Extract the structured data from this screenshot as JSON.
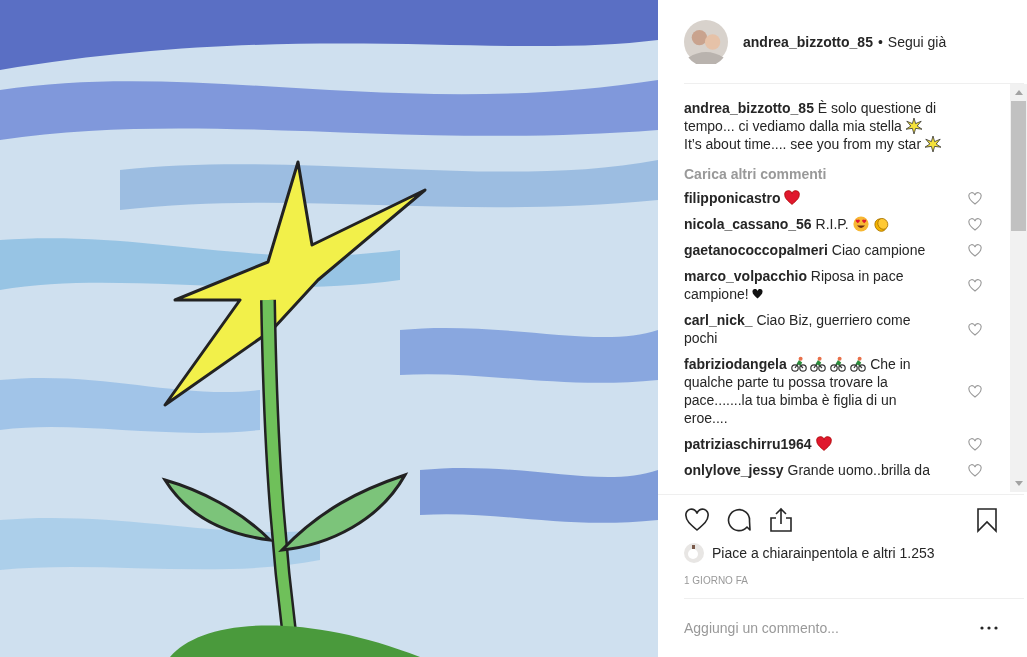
{
  "header": {
    "username": "andrea_bizzotto_85",
    "separator": "•",
    "follow": "Segui già"
  },
  "caption": {
    "username": "andrea_bizzotto_85",
    "lines": [
      [
        {
          "kind": "text",
          "text": "È solo questione di tempo... ci vediamo dalla mia stella"
        },
        {
          "kind": "sparkle"
        }
      ],
      [
        {
          "kind": "text",
          "text": "It’s about time.... see you from my star"
        },
        {
          "kind": "sparkle"
        }
      ]
    ]
  },
  "load_more": "Carica altri commenti",
  "comments": [
    {
      "username": "filipponicastro",
      "parts": [
        {
          "kind": "heart"
        }
      ]
    },
    {
      "username": "nicola_cassano_56",
      "parts": [
        {
          "kind": "text",
          "text": "R.I.P."
        },
        {
          "kind": "hearteyes"
        },
        {
          "kind": "clap"
        }
      ]
    },
    {
      "username": "gaetanococcopalmeri",
      "parts": [
        {
          "kind": "text",
          "text": "Ciao campione"
        }
      ]
    },
    {
      "username": "marco_volpacchio",
      "parts": [
        {
          "kind": "text",
          "text": "Riposa in pace campione!"
        },
        {
          "kind": "blackheart"
        }
      ]
    },
    {
      "username": "carl_nick_",
      "parts": [
        {
          "kind": "text",
          "text": "Ciao Biz, guerriero come pochi"
        }
      ]
    },
    {
      "username": "fabriziodangela",
      "parts": [
        {
          "kind": "cyclist"
        },
        {
          "kind": "cyclist"
        },
        {
          "kind": "cyclist"
        },
        {
          "kind": "cyclist"
        },
        {
          "kind": "text",
          "text": "Che in qualche parte tu possa trovare la pace.......la tua bimba è figlia di un eroe...."
        }
      ]
    },
    {
      "username": "patriziaschirru1964",
      "parts": [
        {
          "kind": "heart"
        }
      ]
    },
    {
      "username": "onlylove_jessy",
      "parts": [
        {
          "kind": "text",
          "text": "Grande uomo..brilla da"
        }
      ]
    }
  ],
  "likes": "Piace a chiarainpentola e altri 1.253",
  "time": "1 GIORNO FA",
  "comment_field": {
    "placeholder": "Aggiungi un commento..."
  }
}
